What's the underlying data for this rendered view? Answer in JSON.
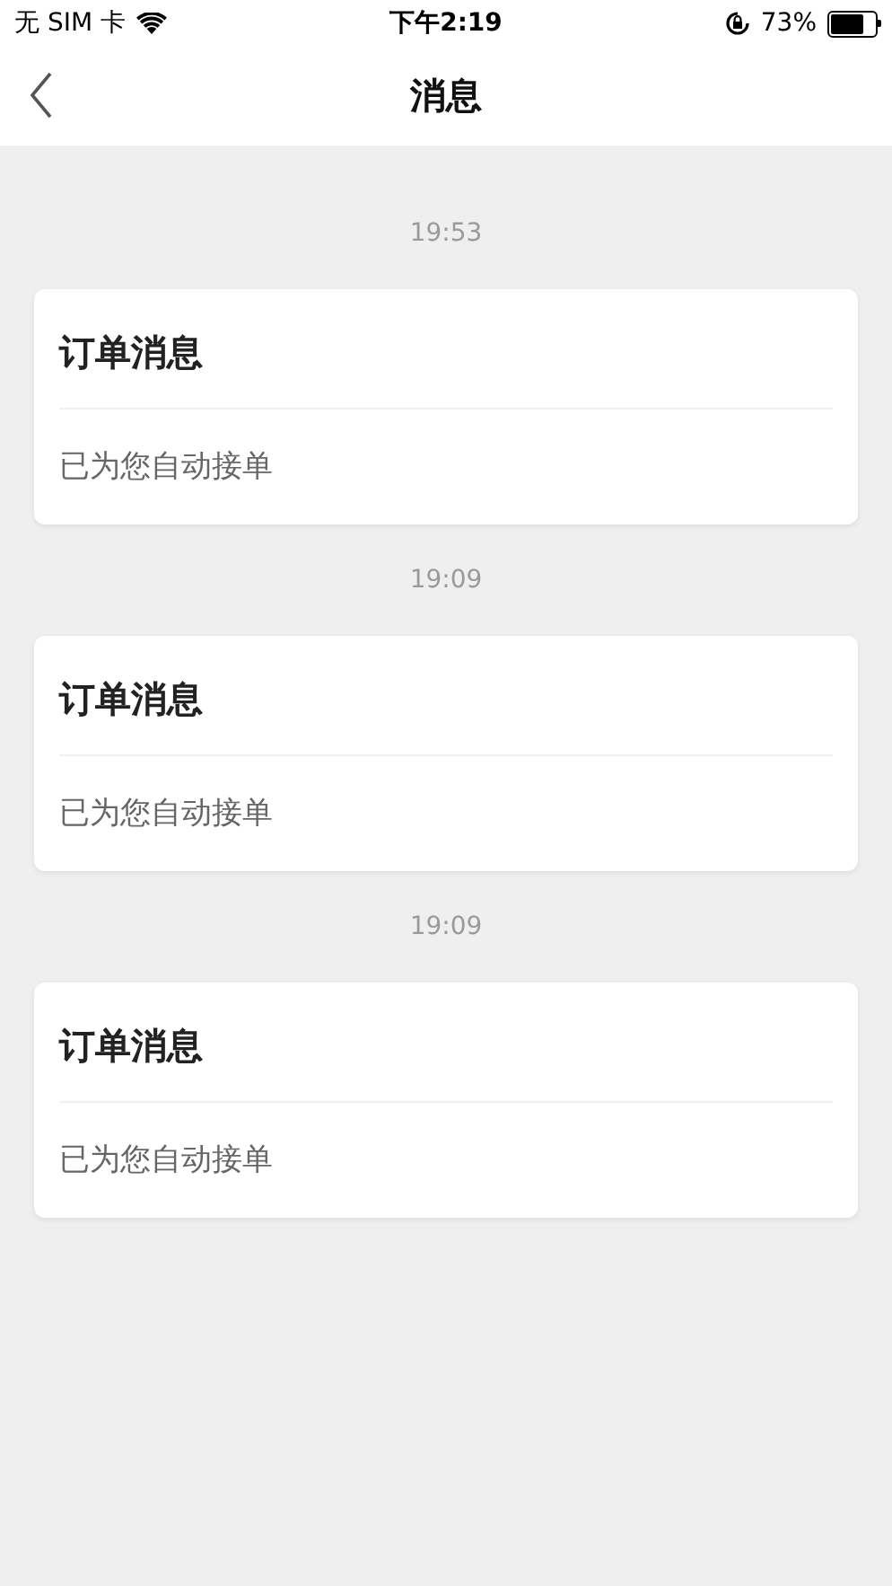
{
  "status_bar": {
    "carrier": "无 SIM 卡",
    "time": "下午2:19",
    "battery": "73%"
  },
  "nav": {
    "title": "消息"
  },
  "messages": [
    {
      "time": "19:53",
      "title": "订单消息",
      "body": "已为您自动接单"
    },
    {
      "time": "19:09",
      "title": "订单消息",
      "body": "已为您自动接单"
    },
    {
      "time": "19:09",
      "title": "订单消息",
      "body": "已为您自动接单"
    }
  ]
}
